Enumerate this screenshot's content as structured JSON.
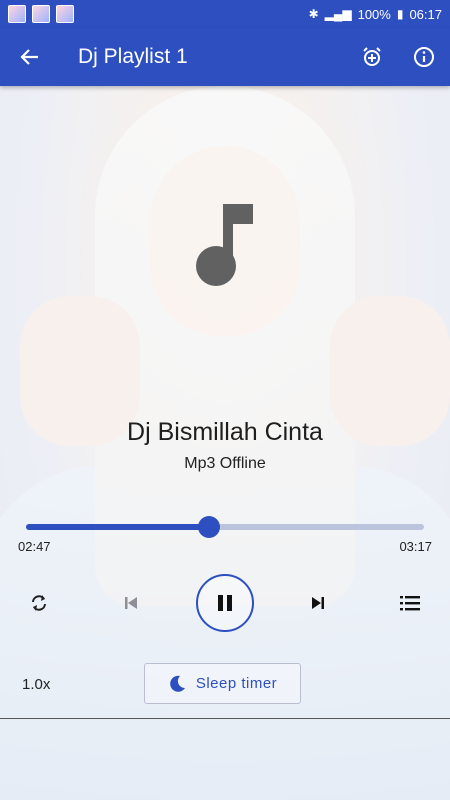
{
  "status_bar": {
    "battery": "100%",
    "time": "06:17"
  },
  "app_bar": {
    "title": "Dj Playlist 1"
  },
  "track": {
    "title": "Dj Bismillah Cinta",
    "subtitle": "Mp3 Offline"
  },
  "playback": {
    "elapsed": "02:47",
    "total": "03:17",
    "progress_fraction": 0.46
  },
  "controls": {
    "speed": "1.0x",
    "sleep_timer_label": "Sleep timer"
  },
  "colors": {
    "accent": "#2d4fc0",
    "note_icon": "#616161"
  },
  "icons": {
    "back": "arrow-left-icon",
    "alarm": "alarm-add-icon",
    "info": "info-icon",
    "note": "music-note-icon",
    "repeat": "repeat-icon",
    "previous": "skip-previous-icon",
    "pause": "pause-icon",
    "next": "skip-next-icon",
    "queue": "queue-list-icon",
    "moon": "moon-icon"
  }
}
